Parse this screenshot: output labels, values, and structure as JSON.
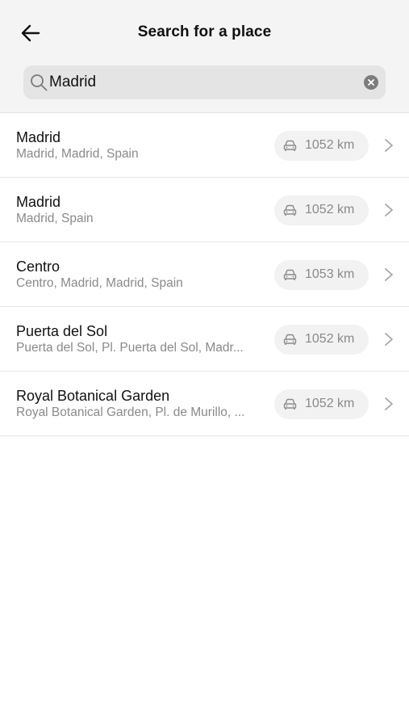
{
  "header": {
    "title": "Search for a place",
    "back_icon": "arrow-left-icon"
  },
  "search": {
    "value": "Madrid",
    "search_icon": "search-icon",
    "clear_icon": "close-circle-icon"
  },
  "results": [
    {
      "name": "Madrid",
      "address": "Madrid, Madrid, Spain",
      "distance": "1052 km"
    },
    {
      "name": "Madrid",
      "address": "Madrid, Spain",
      "distance": "1052 km"
    },
    {
      "name": "Centro",
      "address": "Centro, Madrid, Madrid, Spain",
      "distance": "1053 km"
    },
    {
      "name": "Puerta del Sol",
      "address": "Puerta del Sol, Pl. Puerta del Sol, Madr...",
      "distance": "1052 km"
    },
    {
      "name": "Royal Botanical Garden",
      "address": "Royal Botanical Garden, Pl. de Murillo, ...",
      "distance": "1052 km"
    }
  ],
  "icons": {
    "distance_icon": "car-icon",
    "row_icon": "chevron-right-icon"
  },
  "colors": {
    "header_bg": "#f4f4f4",
    "search_bg": "#e4e4e4",
    "pill_bg": "#f2f2f2",
    "secondary_text": "#8a8a8a"
  }
}
